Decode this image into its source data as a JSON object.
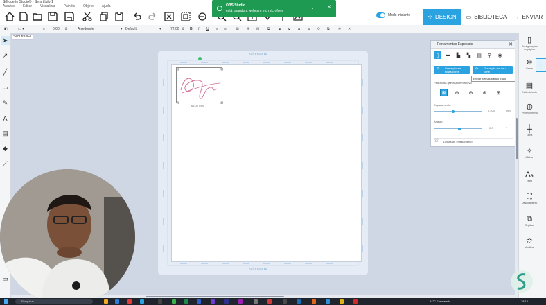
{
  "window": {
    "title": "Silhouette Studio® - Sem título-1"
  },
  "menu": [
    "Arquivo",
    "Editar",
    "Visualizar",
    "Painéis",
    "Objeto",
    "Ajuda"
  ],
  "toolbar": {
    "icons": [
      "new-file-icon",
      "open-file-icon",
      "save-icon",
      "save-as-icon",
      "cut-icon",
      "copy-icon",
      "paste-icon",
      "undo-icon",
      "redo-icon",
      "delete-icon",
      "group-icon",
      "ungroup-icon",
      "compound-icon",
      "zoom-in-icon",
      "zoom-out-icon",
      "fit-page-icon",
      "move-icon",
      "pan-icon"
    ],
    "toggle_label": "Modo iniciante",
    "tab_design": "DESIGN",
    "tab_library": "BIBLIOTECA",
    "tab_send": "ENVIAR"
  },
  "propbar": {
    "line_width": "0.00",
    "line_style": "Arredonde",
    "font_name": "Default",
    "font_size": "72,00"
  },
  "doc_tab": "Sem título-1",
  "notification": {
    "title": "OBS Studio",
    "message": "está usando a webcam e o microfone"
  },
  "mat": {
    "logo": "silhouette",
    "design_width": "65,00 mm"
  },
  "panel": {
    "title": "Ferramentas Especiais",
    "btn_engrave_fill": "Gravação em todas cores",
    "btn_engrave_outline": "Gravação em seu corte",
    "tooltip": "Enviar formas para o traço",
    "pattern_label": "Padrão da gravação em relevo",
    "spacing_label": "Espaçamento",
    "spacing_value": "0,200",
    "spacing_unit": "mm",
    "angle_label": "Ângulo",
    "angle_value": "0,0",
    "angle_unit": "°",
    "footer_label": "Linhas de engajamento"
  },
  "right_panel": [
    {
      "icon": "page-icon",
      "label": "Configurações de página"
    },
    {
      "icon": "grid-icon",
      "label": "Grade"
    },
    {
      "icon": "text-style-icon",
      "label": "Estilo de texto"
    },
    {
      "icon": "fill-icon",
      "label": "Preenchimento"
    },
    {
      "icon": "line-icon",
      "label": "Linha"
    },
    {
      "icon": "align-icon",
      "label": "Alinhar"
    },
    {
      "icon": "trace-icon",
      "label": "Traçar"
    },
    {
      "icon": "text-icon",
      "label": "Texto"
    },
    {
      "icon": "offset-icon",
      "label": "Deslocamento"
    },
    {
      "icon": "replicate-icon",
      "label": "Replicar"
    },
    {
      "icon": "modify-icon",
      "label": "Modificar"
    }
  ],
  "taskbar": {
    "search_placeholder": "Pesquisar",
    "weather": "24°C  Ensolarado",
    "time": "18:12"
  },
  "colors": {
    "accent": "#2aa3e0",
    "notification": "#1e9a52",
    "mat": "#e6ecf5",
    "design_stroke": "#d4739a"
  }
}
